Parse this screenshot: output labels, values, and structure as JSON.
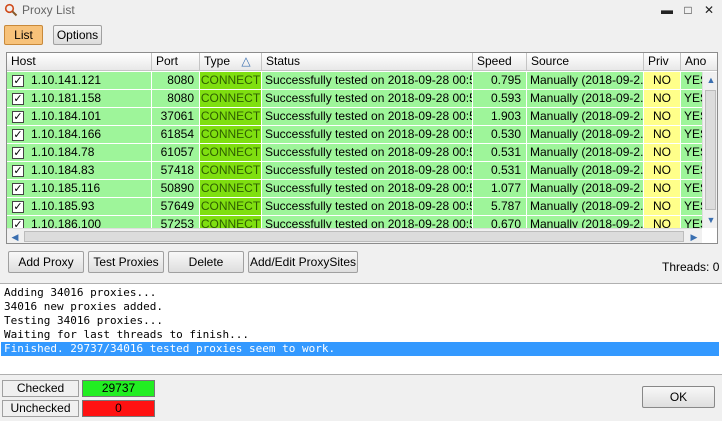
{
  "window": {
    "title": "Proxy List",
    "minimize": "▬",
    "maximize": "□",
    "close": "✕"
  },
  "tabs": {
    "list": "List",
    "options": "Options"
  },
  "grid": {
    "columns": [
      "Host",
      "Port",
      "Type",
      "Status",
      "Speed",
      "Source",
      "Priv",
      "Ano"
    ],
    "sort_indicator": "△",
    "rows": [
      {
        "host": "1.10.141.121",
        "port": "8080",
        "type": "CONNECT",
        "status": "Successfully tested on 2018-09-28 00:5...",
        "speed": "0.795",
        "source": "Manually (2018-09-2...",
        "priv": "NO",
        "ano": "YES"
      },
      {
        "host": "1.10.181.158",
        "port": "8080",
        "type": "CONNECT",
        "status": "Successfully tested on 2018-09-28 00:5...",
        "speed": "0.593",
        "source": "Manually (2018-09-2...",
        "priv": "NO",
        "ano": "YES"
      },
      {
        "host": "1.10.184.101",
        "port": "37061",
        "type": "CONNECT",
        "status": "Successfully tested on 2018-09-28 00:5...",
        "speed": "1.903",
        "source": "Manually (2018-09-2...",
        "priv": "NO",
        "ano": "YES"
      },
      {
        "host": "1.10.184.166",
        "port": "61854",
        "type": "CONNECT",
        "status": "Successfully tested on 2018-09-28 00:5...",
        "speed": "0.530",
        "source": "Manually (2018-09-2...",
        "priv": "NO",
        "ano": "YES"
      },
      {
        "host": "1.10.184.78",
        "port": "61057",
        "type": "CONNECT",
        "status": "Successfully tested on 2018-09-28 00:5...",
        "speed": "0.531",
        "source": "Manually (2018-09-2...",
        "priv": "NO",
        "ano": "YES"
      },
      {
        "host": "1.10.184.83",
        "port": "57418",
        "type": "CONNECT",
        "status": "Successfully tested on 2018-09-28 00:5...",
        "speed": "0.531",
        "source": "Manually (2018-09-2...",
        "priv": "NO",
        "ano": "YES"
      },
      {
        "host": "1.10.185.116",
        "port": "50890",
        "type": "CONNECT",
        "status": "Successfully tested on 2018-09-28 00:5...",
        "speed": "1.077",
        "source": "Manually (2018-09-2...",
        "priv": "NO",
        "ano": "YES"
      },
      {
        "host": "1.10.185.93",
        "port": "57649",
        "type": "CONNECT",
        "status": "Successfully tested on 2018-09-28 00:5...",
        "speed": "5.787",
        "source": "Manually (2018-09-2...",
        "priv": "NO",
        "ano": "YES"
      },
      {
        "host": "1.10.186.100",
        "port": "57253",
        "type": "CONNECT",
        "status": "Successfully tested on 2018-09-28 00:5...",
        "speed": "0.670",
        "source": "Manually (2018-09-2...",
        "priv": "NO",
        "ano": "YES"
      }
    ]
  },
  "buttons": {
    "add_proxy": "Add Proxy",
    "test_proxies": "Test Proxies",
    "delete": "Delete",
    "add_edit_proxysites": "Add/Edit ProxySites",
    "ok": "OK"
  },
  "threads": "Threads: 0",
  "log": [
    "Adding 34016 proxies...",
    "34016 new proxies added.",
    "Testing 34016 proxies...",
    "Waiting for last threads to finish...",
    "Finished. 29737/34016 tested proxies seem to work."
  ],
  "status": {
    "checked_label": "Checked",
    "checked_value": "29737",
    "unchecked_label": "Unchecked",
    "unchecked_value": "0"
  },
  "colors": {
    "row_bg": "#9ef59a",
    "type_bg": "#7fdf10",
    "priv_bg": "#ffff8a",
    "checked_bg": "#22ee22",
    "unchecked_bg": "#ff1111",
    "log_selection": "#3399ff"
  }
}
